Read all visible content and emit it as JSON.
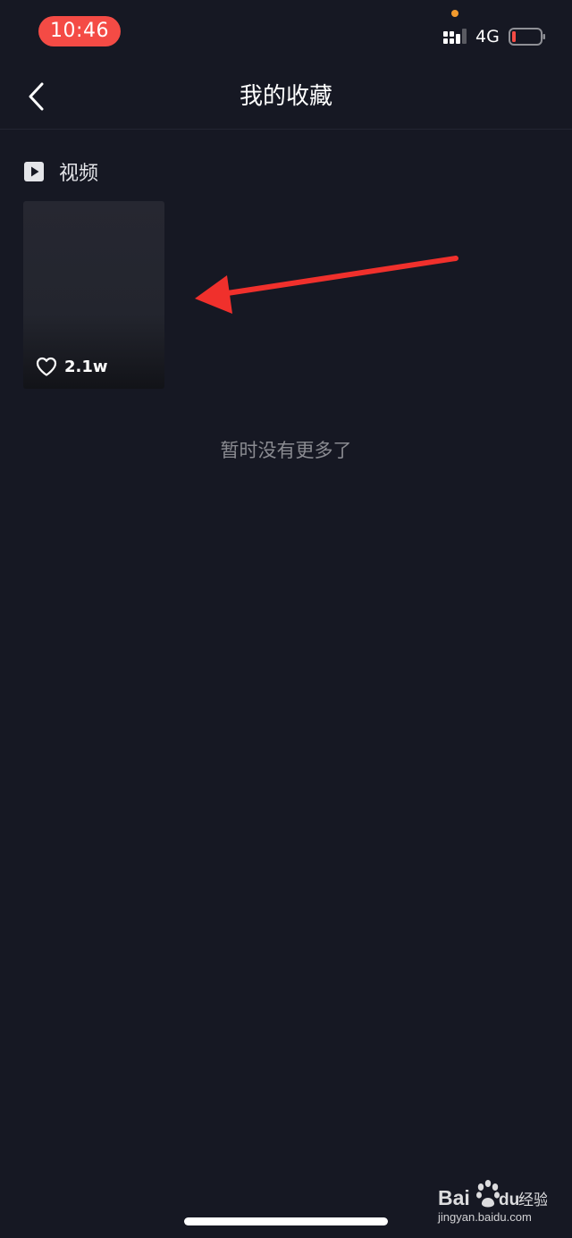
{
  "status_bar": {
    "time": "10:46",
    "network": "4G",
    "signal_icon": "cellular-signal-icon",
    "battery_icon": "battery-low-icon",
    "indicator_color": "#f29a2e"
  },
  "nav": {
    "back_icon": "chevron-left-icon",
    "title": "我的收藏"
  },
  "section": {
    "icon": "video-play-icon",
    "label": "视频"
  },
  "videos": [
    {
      "like_icon": "heart-outline-icon",
      "likes": "2.1w"
    }
  ],
  "empty_message": "暂时没有更多了",
  "annotation": {
    "icon": "red-arrow",
    "color": "#f0302c"
  },
  "watermark": {
    "logo": "baidu-paw-icon",
    "brand": "Bai",
    "brand_suffix": "du",
    "product": "经验",
    "url": "jingyan.baidu.com"
  },
  "colors": {
    "background": "#161823",
    "time_pill": "#f44b45",
    "battery_level": "#f44b45"
  }
}
